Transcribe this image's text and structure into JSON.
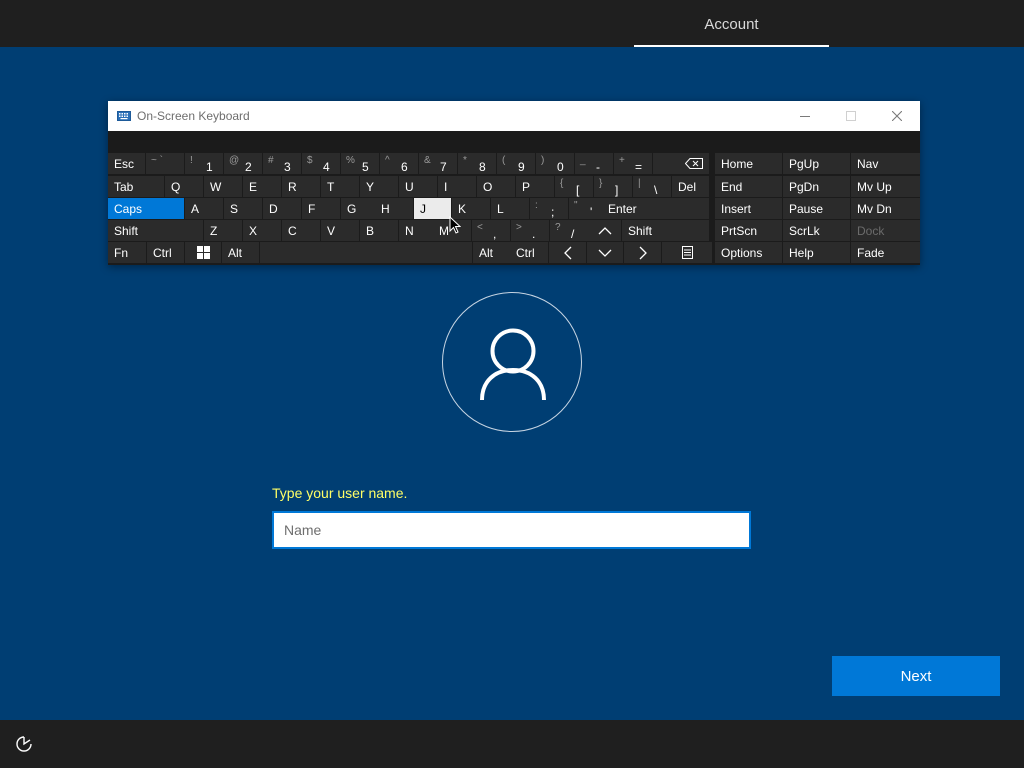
{
  "header": {
    "tab_label": "Account"
  },
  "osk": {
    "title": "On-Screen Keyboard",
    "rows": [
      [
        {
          "label": "Esc"
        },
        {
          "shift": "~ `",
          "main": ""
        },
        {
          "shift": "!",
          "main": "1"
        },
        {
          "shift": "@",
          "main": "2"
        },
        {
          "shift": "#",
          "main": "3"
        },
        {
          "shift": "$",
          "main": "4"
        },
        {
          "shift": "%",
          "main": "5"
        },
        {
          "shift": "^",
          "main": "6"
        },
        {
          "shift": "&",
          "main": "7"
        },
        {
          "shift": "*",
          "main": "8"
        },
        {
          "shift": "(",
          "main": "9"
        },
        {
          "shift": ")",
          "main": "0"
        },
        {
          "shift": "_",
          "main": "-"
        },
        {
          "shift": "+",
          "main": "="
        },
        {
          "label": "",
          "icon": "backspace-icon"
        },
        {
          "label": "Home"
        },
        {
          "label": "PgUp"
        },
        {
          "label": "Nav"
        }
      ],
      [
        {
          "label": "Tab"
        },
        {
          "label": "Q"
        },
        {
          "label": "W"
        },
        {
          "label": "E"
        },
        {
          "label": "R"
        },
        {
          "label": "T"
        },
        {
          "label": "Y"
        },
        {
          "label": "U"
        },
        {
          "label": "I"
        },
        {
          "label": "O"
        },
        {
          "label": "P"
        },
        {
          "shift": "{",
          "main": "["
        },
        {
          "shift": "}",
          "main": "]"
        },
        {
          "shift": "|",
          "main": "\\"
        },
        {
          "label": "Del"
        },
        {
          "label": "End"
        },
        {
          "label": "PgDn"
        },
        {
          "label": "Mv Up"
        }
      ],
      [
        {
          "label": "Caps"
        },
        {
          "label": "A"
        },
        {
          "label": "S"
        },
        {
          "label": "D"
        },
        {
          "label": "F"
        },
        {
          "label": "G"
        },
        {
          "label": "H"
        },
        {
          "label": "J"
        },
        {
          "label": "K"
        },
        {
          "label": "L"
        },
        {
          "shift": ":",
          "main": ";"
        },
        {
          "shift": "\"",
          "main": "'"
        },
        {
          "label": "Enter"
        },
        {
          "label": "Insert"
        },
        {
          "label": "Pause"
        },
        {
          "label": "Mv Dn"
        }
      ],
      [
        {
          "label": "Shift"
        },
        {
          "label": "Z"
        },
        {
          "label": "X"
        },
        {
          "label": "C"
        },
        {
          "label": "V"
        },
        {
          "label": "B"
        },
        {
          "label": "N"
        },
        {
          "label": "M"
        },
        {
          "shift": "<",
          "main": ","
        },
        {
          "shift": ">",
          "main": "."
        },
        {
          "shift": "?",
          "main": "/"
        },
        {
          "label": "",
          "icon": "arrow-up-icon"
        },
        {
          "label": "Shift"
        },
        {
          "label": "PrtScn"
        },
        {
          "label": "ScrLk"
        },
        {
          "label": "Dock"
        }
      ],
      [
        {
          "label": "Fn"
        },
        {
          "label": "Ctrl"
        },
        {
          "label": "",
          "icon": "windows-logo-icon"
        },
        {
          "label": "Alt"
        },
        {
          "label": ""
        },
        {
          "label": "Alt"
        },
        {
          "label": "Ctrl"
        },
        {
          "label": "",
          "icon": "arrow-left-icon"
        },
        {
          "label": "",
          "icon": "arrow-down-icon"
        },
        {
          "label": "",
          "icon": "arrow-right-icon"
        },
        {
          "label": "",
          "icon": "menu-key-icon"
        },
        {
          "label": "Options"
        },
        {
          "label": "Help"
        },
        {
          "label": "Fade"
        }
      ]
    ],
    "active_key": "Caps",
    "pressed_key": "J",
    "disabled_key": "Dock"
  },
  "account": {
    "prompt": "Type your user name.",
    "name_placeholder": "Name",
    "name_value": ""
  },
  "footer": {
    "next_label": "Next"
  },
  "colors": {
    "background": "#003e73",
    "accent": "#0078d7",
    "prompt": "#ffff66",
    "bars": "#1f1f1f"
  }
}
